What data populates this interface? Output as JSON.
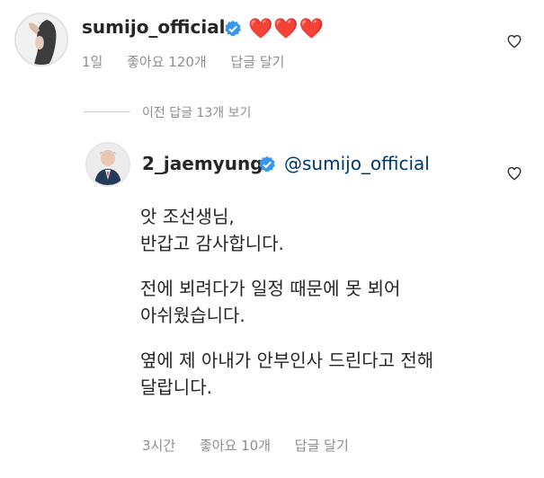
{
  "comment": {
    "username": "sumijo_official",
    "text": "❤️❤️❤️",
    "meta": {
      "time": "1일",
      "likes": "좋아요 120개",
      "reply": "답글 달기"
    }
  },
  "view_previous": "이전 답글 13개 보기",
  "reply": {
    "username": "2_jaemyung",
    "mention": "@sumijo_official",
    "paragraphs": [
      "앗 조선생님,\n반갑고 감사합니다.",
      "전에 뵈려다가 일정 때문에 못 뵈어\n아쉬웠습니다.",
      "옆에 제 아내가 안부인사 드린다고 전해\n달랍니다."
    ],
    "meta": {
      "time": "3시간",
      "likes": "좋아요 10개",
      "reply": "답글 달기"
    }
  },
  "colors": {
    "verified": "#3897f0",
    "heart": "#e0262f",
    "mention": "#00376b",
    "meta_text": "#8e8e8e"
  },
  "icons": {
    "verified": "verified-badge-icon",
    "like": "heart-outline-icon"
  }
}
